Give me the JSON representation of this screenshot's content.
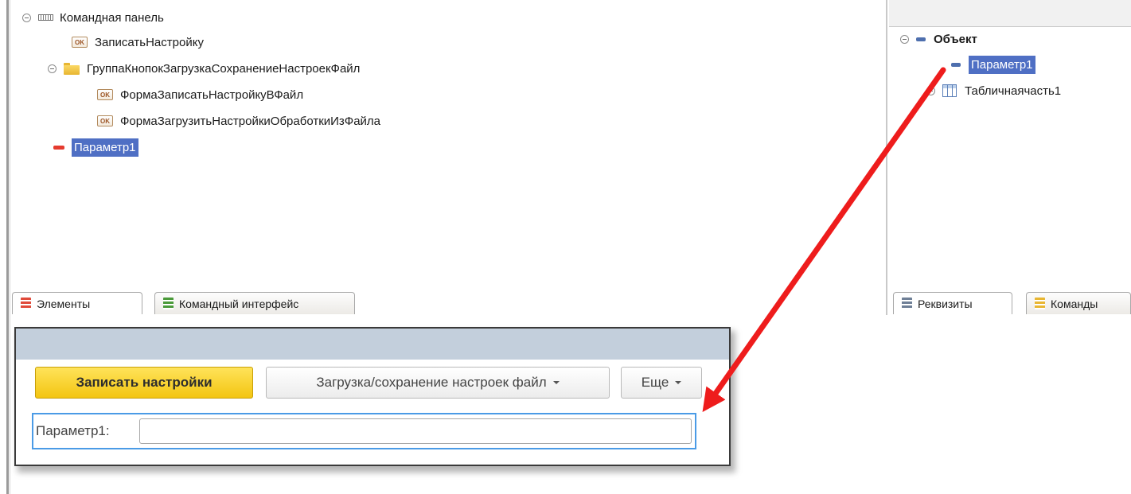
{
  "elements_tree": {
    "command_panel": "Командная панель",
    "items": [
      "ЗаписатьНастройку",
      "ГруппаКнопокЗагрузкаСохранениеНастроекФайл",
      "ФормаЗаписатьНастройкуВФайл",
      "ФормаЗагрузитьНастройкиОбработкиИзФайла",
      "Параметр1"
    ],
    "ok_badge": "OK",
    "tabs": [
      "Элементы",
      "Командный интерфейс"
    ]
  },
  "attributes_tree": {
    "root": "Объект",
    "items": [
      "Параметр1",
      "Табличнаячасть1"
    ],
    "tabs": [
      "Реквизиты",
      "Команды"
    ]
  },
  "form_preview": {
    "save_button": "Записать настройки",
    "load_save_menu": "Загрузка/сохранение настроек файл",
    "more_menu": "Еще",
    "field_label": "Параметр1:",
    "field_value": ""
  },
  "colors": {
    "selection": "#4f6fc4",
    "primary_button": "#f3c511",
    "arrow": "#ee1c1c",
    "field_focus": "#4a9be6"
  }
}
